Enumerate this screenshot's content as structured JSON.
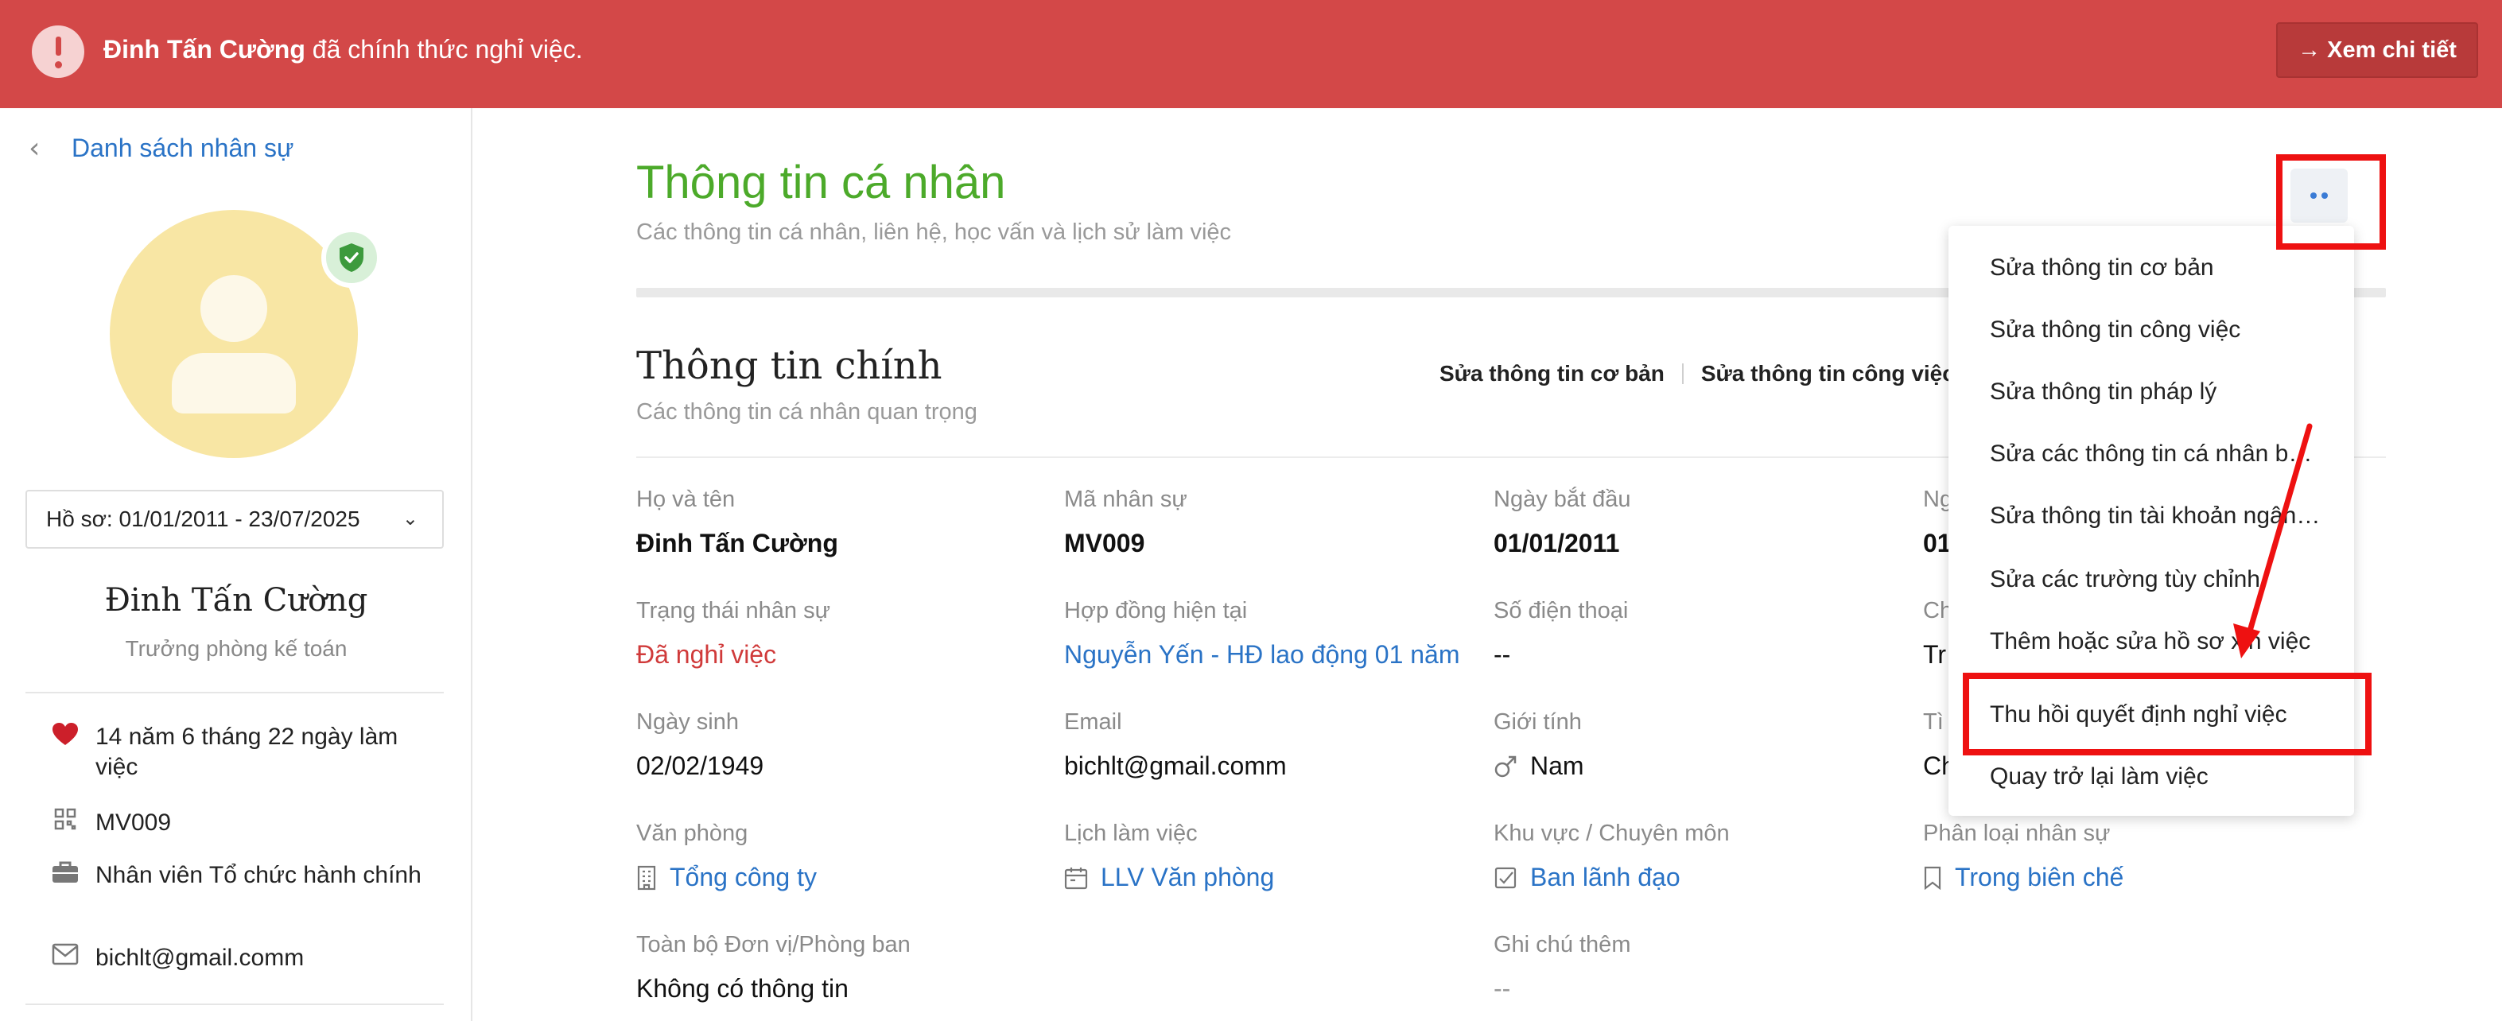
{
  "banner": {
    "name": "Đinh Tấn Cường",
    "message": "đã chính thức nghỉ việc.",
    "detail_button": "→ Xem chi tiết",
    "color": "#d34848"
  },
  "sidebar": {
    "back_label": "Danh sách nhân sự",
    "profile_range": "Hồ sơ: 01/01/2011 - 23/07/2025",
    "name": "Đinh Tấn Cường",
    "job_title": "Trưởng phòng kế toán",
    "info": [
      {
        "icon": "heart-icon",
        "text": "14 năm 6 tháng 22 ngày làm việc"
      },
      {
        "icon": "qr-code-icon",
        "text": "MV009"
      },
      {
        "icon": "briefcase-icon",
        "text": "Nhân viên Tổ chức hành chính"
      },
      {
        "icon": "mail-icon",
        "text": "bichlt@gmail.comm"
      }
    ]
  },
  "main": {
    "title": "Thông tin cá nhân",
    "subtitle": "Các thông tin cá nhân, liên hệ, học vấn và lịch sử làm việc",
    "section": {
      "title": "Thông tin chính",
      "subtitle": "Các thông tin cá nhân quan trọng",
      "edit_basic": "Sửa thông tin cơ bản",
      "edit_work": "Sửa thông tin công việc"
    },
    "fields": {
      "full_name": {
        "label": "Họ và tên",
        "value": "Đinh Tấn Cường"
      },
      "employee_code": {
        "label": "Mã nhân sự",
        "value": "MV009"
      },
      "start_date": {
        "label": "Ngày bắt đầu",
        "value": "01/01/2011"
      },
      "col4_label_1": "Ng",
      "col4_value_1": "01",
      "status": {
        "label": "Trạng thái nhân sự",
        "value": "Đã nghỉ việc"
      },
      "contract": {
        "label": "Hợp đồng hiện tại",
        "value": "Nguyễn Yến - HĐ lao động 01 năm"
      },
      "phone": {
        "label": "Số điện thoại",
        "value": "--"
      },
      "col4_label_2": "Ch",
      "col4_value_2": "Tr",
      "dob": {
        "label": "Ngày sinh",
        "value": "02/02/1949"
      },
      "email": {
        "label": "Email",
        "value": "bichlt@gmail.comm"
      },
      "gender": {
        "label": "Giới tính",
        "value": "Nam"
      },
      "col4_label_3": "Tì",
      "col4_value_3": "Ch",
      "office": {
        "label": "Văn phòng",
        "value": "Tổng công ty"
      },
      "schedule": {
        "label": "Lịch làm việc",
        "value": "LLV Văn phòng"
      },
      "region": {
        "label": "Khu vực / Chuyên môn",
        "value": "Ban lãnh đạo"
      },
      "classification": {
        "label": "Phân loại nhân sự",
        "value": "Trong biên chế"
      },
      "departments": {
        "label": "Toàn bộ Đơn vị/Phòng ban",
        "value": "Không có thông tin"
      },
      "notes": {
        "label": "Ghi chú thêm",
        "value": "--"
      }
    }
  },
  "menu": {
    "items": [
      "Sửa thông tin cơ bản",
      "Sửa thông tin công việc",
      "Sửa thông tin pháp lý",
      "Sửa các thông tin cá nhân bổ sung",
      "Sửa thông tin tài khoản ngân hàng",
      "Sửa các trường tùy chỉnh",
      "Thêm hoặc sửa hồ sơ xin việc",
      "Thu hồi quyết định nghỉ việc",
      "Quay trở lại làm việc"
    ]
  },
  "colors": {
    "accent_green": "#4caa2a",
    "link_blue": "#2a73c6",
    "status_red": "#d03a3a",
    "annotation_red": "#ee1111"
  }
}
